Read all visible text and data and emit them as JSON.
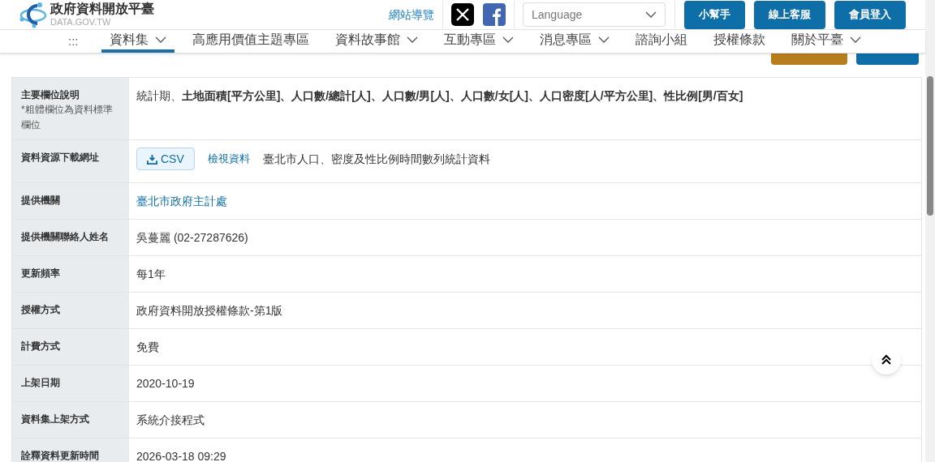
{
  "header": {
    "site_name": "政府資料開放平臺",
    "site_domain": "DATA.GOV.TW",
    "sitemap_link": "網站導覽",
    "language_select": {
      "placeholder": "Language"
    },
    "buttons": [
      "小幫手",
      "線上客服",
      "會員登入"
    ]
  },
  "nav": {
    "menu_glyph": ":::",
    "items": [
      {
        "label": "資料集",
        "has_dropdown": true,
        "selected": true
      },
      {
        "label": "高應用價值主題專區",
        "has_dropdown": false,
        "selected": false
      },
      {
        "label": "資料故事館",
        "has_dropdown": true,
        "selected": false
      },
      {
        "label": "互動專區",
        "has_dropdown": true,
        "selected": false
      },
      {
        "label": "消息專區",
        "has_dropdown": true,
        "selected": false
      },
      {
        "label": "諮詢小組",
        "has_dropdown": false,
        "selected": false
      },
      {
        "label": "授權條款",
        "has_dropdown": false,
        "selected": false
      },
      {
        "label": "關於平臺",
        "has_dropdown": true,
        "selected": false
      }
    ]
  },
  "table": {
    "rows": [
      {
        "label": "主要欄位說明",
        "note": "*粗體欄位為資料標準欄位",
        "kind": "rich",
        "value": "統計期、**土地面積[平方公里]、人口數/總計[人]、人口數/男[人]、人口數/女[人]、人口密度[人/平方公里]、性比例[男/百女]**"
      },
      {
        "label": "資料資源下載網址",
        "kind": "download",
        "format": "CSV",
        "link": "檢視資料",
        "value": "臺北市人口、密度及性比例時間數列統計資料"
      },
      {
        "label": "提供機關",
        "kind": "link",
        "value": "臺北市政府主計處"
      },
      {
        "label": "提供機關聯絡人姓名",
        "kind": "text",
        "value": "吳蔓麗 (02-27287626)"
      },
      {
        "label": "更新頻率",
        "kind": "text",
        "value": "每1年"
      },
      {
        "label": "授權方式",
        "kind": "text",
        "value": "政府資料開放授權條款-第1版"
      },
      {
        "label": "計費方式",
        "kind": "text",
        "value": "免費"
      },
      {
        "label": "上架日期",
        "kind": "text",
        "value": "2020-10-19"
      },
      {
        "label": "資料集上架方式",
        "kind": "text",
        "value": "系統介接程式"
      },
      {
        "label": "詮釋資料更新時間",
        "kind": "text",
        "value": "2026-03-18 09:29"
      }
    ]
  }
}
